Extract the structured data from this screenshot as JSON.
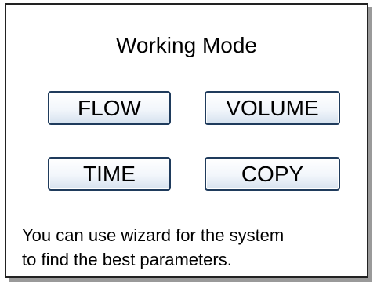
{
  "panel": {
    "title": "Working Mode",
    "modes": [
      {
        "label": "FLOW"
      },
      {
        "label": "VOLUME"
      },
      {
        "label": "TIME"
      },
      {
        "label": "COPY"
      }
    ],
    "info_lines": [
      "You can use wizard for the system",
      "to find the best parameters."
    ]
  },
  "colors": {
    "border": "#222222",
    "button_border": "#1f3b5c",
    "button_gradient_bottom": "#d6e2ef",
    "shadow": "#9a9a9a"
  }
}
